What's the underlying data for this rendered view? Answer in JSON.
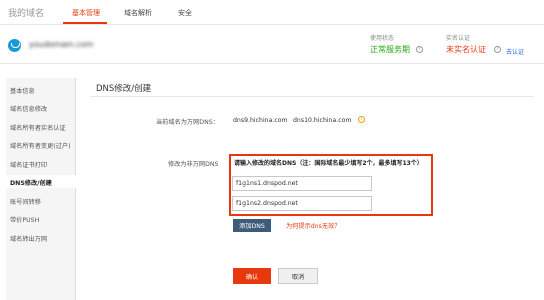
{
  "header": {
    "site_title": "我的域名",
    "tabs": [
      {
        "label": "基本管理"
      },
      {
        "label": "域名解析"
      },
      {
        "label": "安全"
      }
    ],
    "active_tab": "基本管理"
  },
  "infobar": {
    "domain_name": "youdomain.com",
    "usage_status_label": "使用状态",
    "usage_status_value": "正常服务期",
    "realname_label": "实名认证",
    "realname_value": "未实名认证",
    "realname_link": "去认证"
  },
  "sidebar": {
    "items": [
      {
        "label": "基本信息"
      },
      {
        "label": "域名信息修改"
      },
      {
        "label": "域名所有者实名认证"
      },
      {
        "label": "域名所有者变更(过户)"
      },
      {
        "label": "域名证书打印"
      },
      {
        "label": "DNS修改/创建"
      },
      {
        "label": "账号间转移"
      },
      {
        "label": "带价PUSH"
      },
      {
        "label": "域名转出万网"
      }
    ],
    "active_item": "DNS修改/创建"
  },
  "main": {
    "title": "DNS修改/创建",
    "current_dns_label": "当前域名为万网DNS：",
    "current_dns": [
      "dns9.hichina.com",
      "dns10.hichina.com"
    ],
    "modify_label": "修改为非万网DNS",
    "instructions": "请输入修改的域名DNS（注：国际域名最少填写2个，最多填写13个）",
    "dns_inputs": [
      {
        "value": "f1g1ns1.dnspod.net"
      },
      {
        "value": "f1g1ns2.dnspod.net"
      }
    ],
    "add_dns_label": "添加DNS",
    "why_link": "为何提示dns无效？",
    "confirm_label": "确认",
    "cancel_label": "取消"
  },
  "colors": {
    "accent": "#e8380d",
    "ok_green": "#2aa515",
    "link_blue": "#1a6fd8",
    "add_button": "#3f5b7a"
  }
}
